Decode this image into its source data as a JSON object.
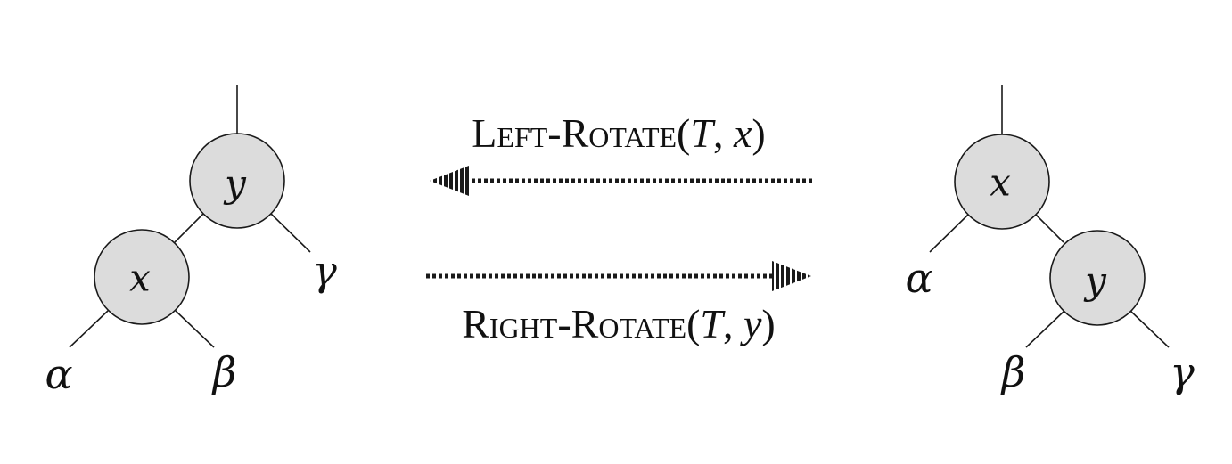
{
  "left_tree": {
    "root": "y",
    "child": "x",
    "subtrees": [
      "α",
      "β",
      "γ"
    ]
  },
  "right_tree": {
    "root": "x",
    "child": "y",
    "subtrees": [
      "α",
      "β",
      "γ"
    ]
  },
  "operations": {
    "left_rotate": "Left-Rotate(T, x)",
    "right_rotate": "Right-Rotate(T, y)"
  }
}
